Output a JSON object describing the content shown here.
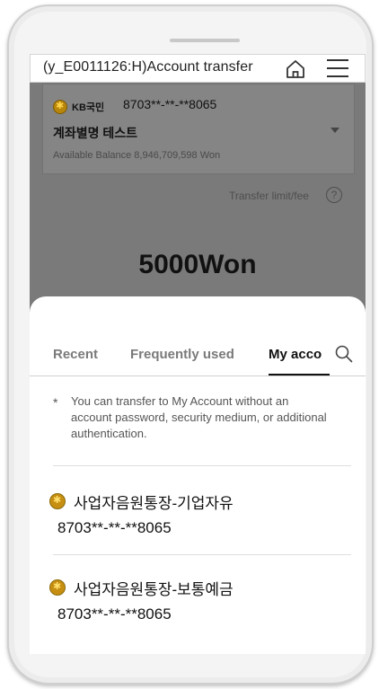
{
  "header": {
    "title": "(y_E0011126:H)Account transfer",
    "home_icon": "home-icon",
    "menu_icon": "hamburger-menu-icon"
  },
  "account": {
    "bank": "KB국민",
    "number": "8703**-**-**8065",
    "alias": "계좌별명 테스트",
    "balance": "Available Balance 8,946,709,598 Won"
  },
  "transfer": {
    "limit_label": "Transfer limit/fee",
    "help_icon": "?",
    "amount": "5000Won"
  },
  "sheet": {
    "tabs": [
      {
        "label": "Recent",
        "selected": false
      },
      {
        "label": "Frequently used",
        "selected": false
      },
      {
        "label": "My acco",
        "selected": true
      }
    ],
    "notice_marker": "*",
    "notice": "You can transfer to My Account without an account password, security medium, or additional authentication.",
    "accounts": [
      {
        "name": "사업자음원통장-기업자유",
        "number": "8703**-**-**8065"
      },
      {
        "name": "사업자음원통장-보통예금",
        "number": "8703**-**-**8065"
      }
    ]
  },
  "colors": {
    "overlay": "#7a7a7a",
    "kb_logo": "#c68f12",
    "active_tab": "#111111",
    "inactive_tab": "#7a7a7a"
  }
}
